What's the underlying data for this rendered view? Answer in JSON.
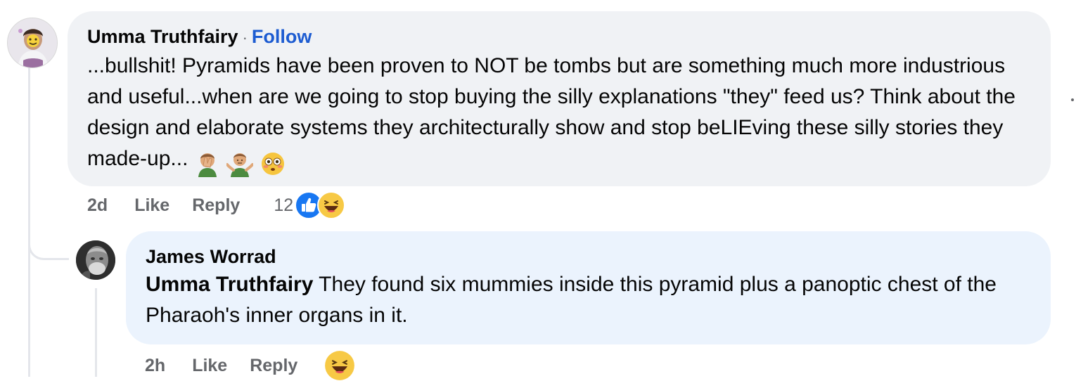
{
  "comment": {
    "author": "Umma Truthfairy",
    "separator": "·",
    "follow_label": "Follow",
    "text": "...bullshit! Pyramids have been proven to NOT be tombs but are something much more industrious and useful...when are we going to stop buying the silly explanations \"they\" feed us? Think about the design and elaborate systems they architecturally show and stop beLIEving these silly stories they made-up...",
    "emojis": [
      "facepalm-emoji",
      "shrug-emoji",
      "flushed-face-emoji"
    ],
    "time": "2d",
    "like_label": "Like",
    "reply_label": "Reply",
    "reaction_count": "12",
    "reactions": [
      "like-reaction",
      "haha-reaction"
    ]
  },
  "reply": {
    "author": "James Worrad",
    "mention": "Umma Truthfairy",
    "text": " They found six mummies inside this pyramid plus a panoptic chest of the Pharaoh's inner organs in it.",
    "time": "2h",
    "like_label": "Like",
    "reply_label": "Reply",
    "reactions": [
      "haha-reaction"
    ]
  },
  "colors": {
    "bubble_gray": "#f0f2f5",
    "bubble_blue": "#ebf3fd",
    "follow_blue": "#1d5cd1",
    "meta_gray": "#65676b",
    "like_blue": "#1877f2",
    "haha_yellow": "#f7c945"
  }
}
